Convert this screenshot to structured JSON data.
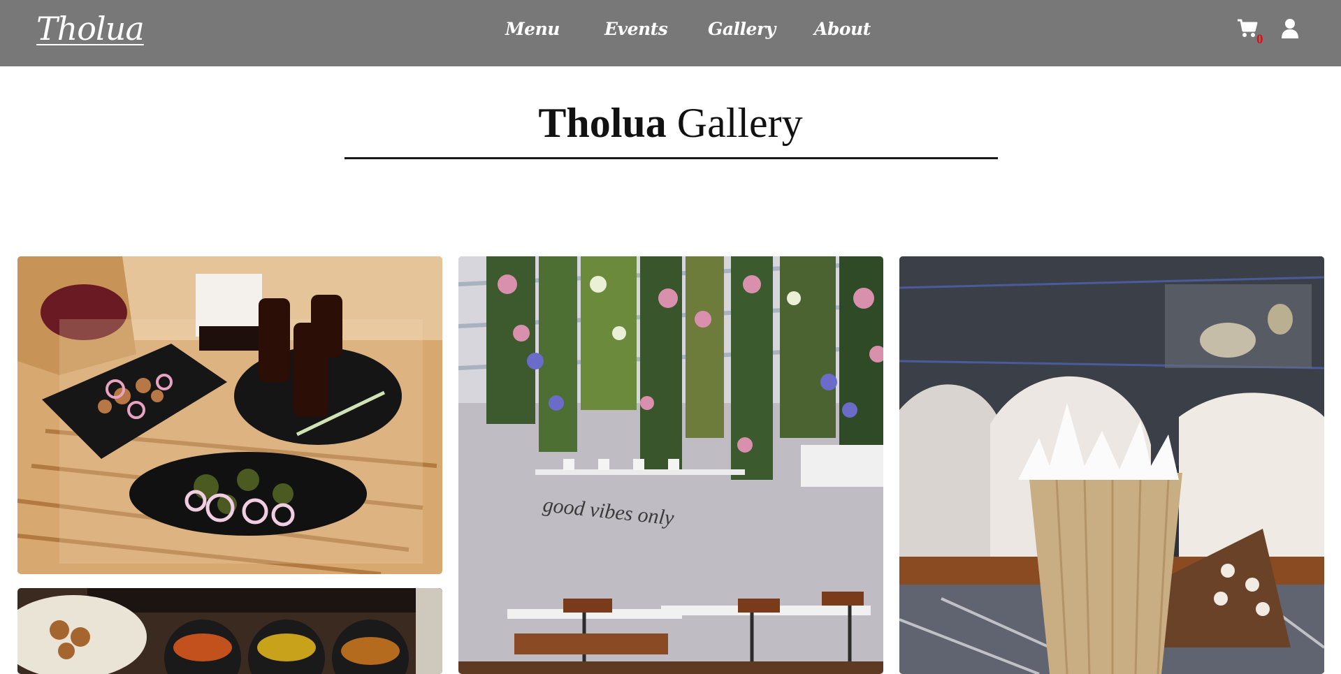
{
  "header": {
    "logo": "Tholua",
    "nav": [
      {
        "label": "Menu"
      },
      {
        "label": "Events"
      },
      {
        "label": "Gallery"
      },
      {
        "label": "About"
      }
    ],
    "cart": {
      "icon": "cart-icon",
      "count": "0",
      "badge_color": "#dd1111"
    },
    "account": {
      "icon": "user-icon"
    },
    "bg_color": "#787878"
  },
  "page": {
    "title_bold": "Tholua",
    "title_rest": "Gallery"
  },
  "gallery": {
    "photos": [
      {
        "name": "food-platter-drinks-photo"
      },
      {
        "name": "hanging-flowers-cafe-interior-photo",
        "wall_text": "good vibes only"
      },
      {
        "name": "milkshake-glass-photo"
      },
      {
        "name": "curry-bowls-thali-photo"
      }
    ]
  }
}
